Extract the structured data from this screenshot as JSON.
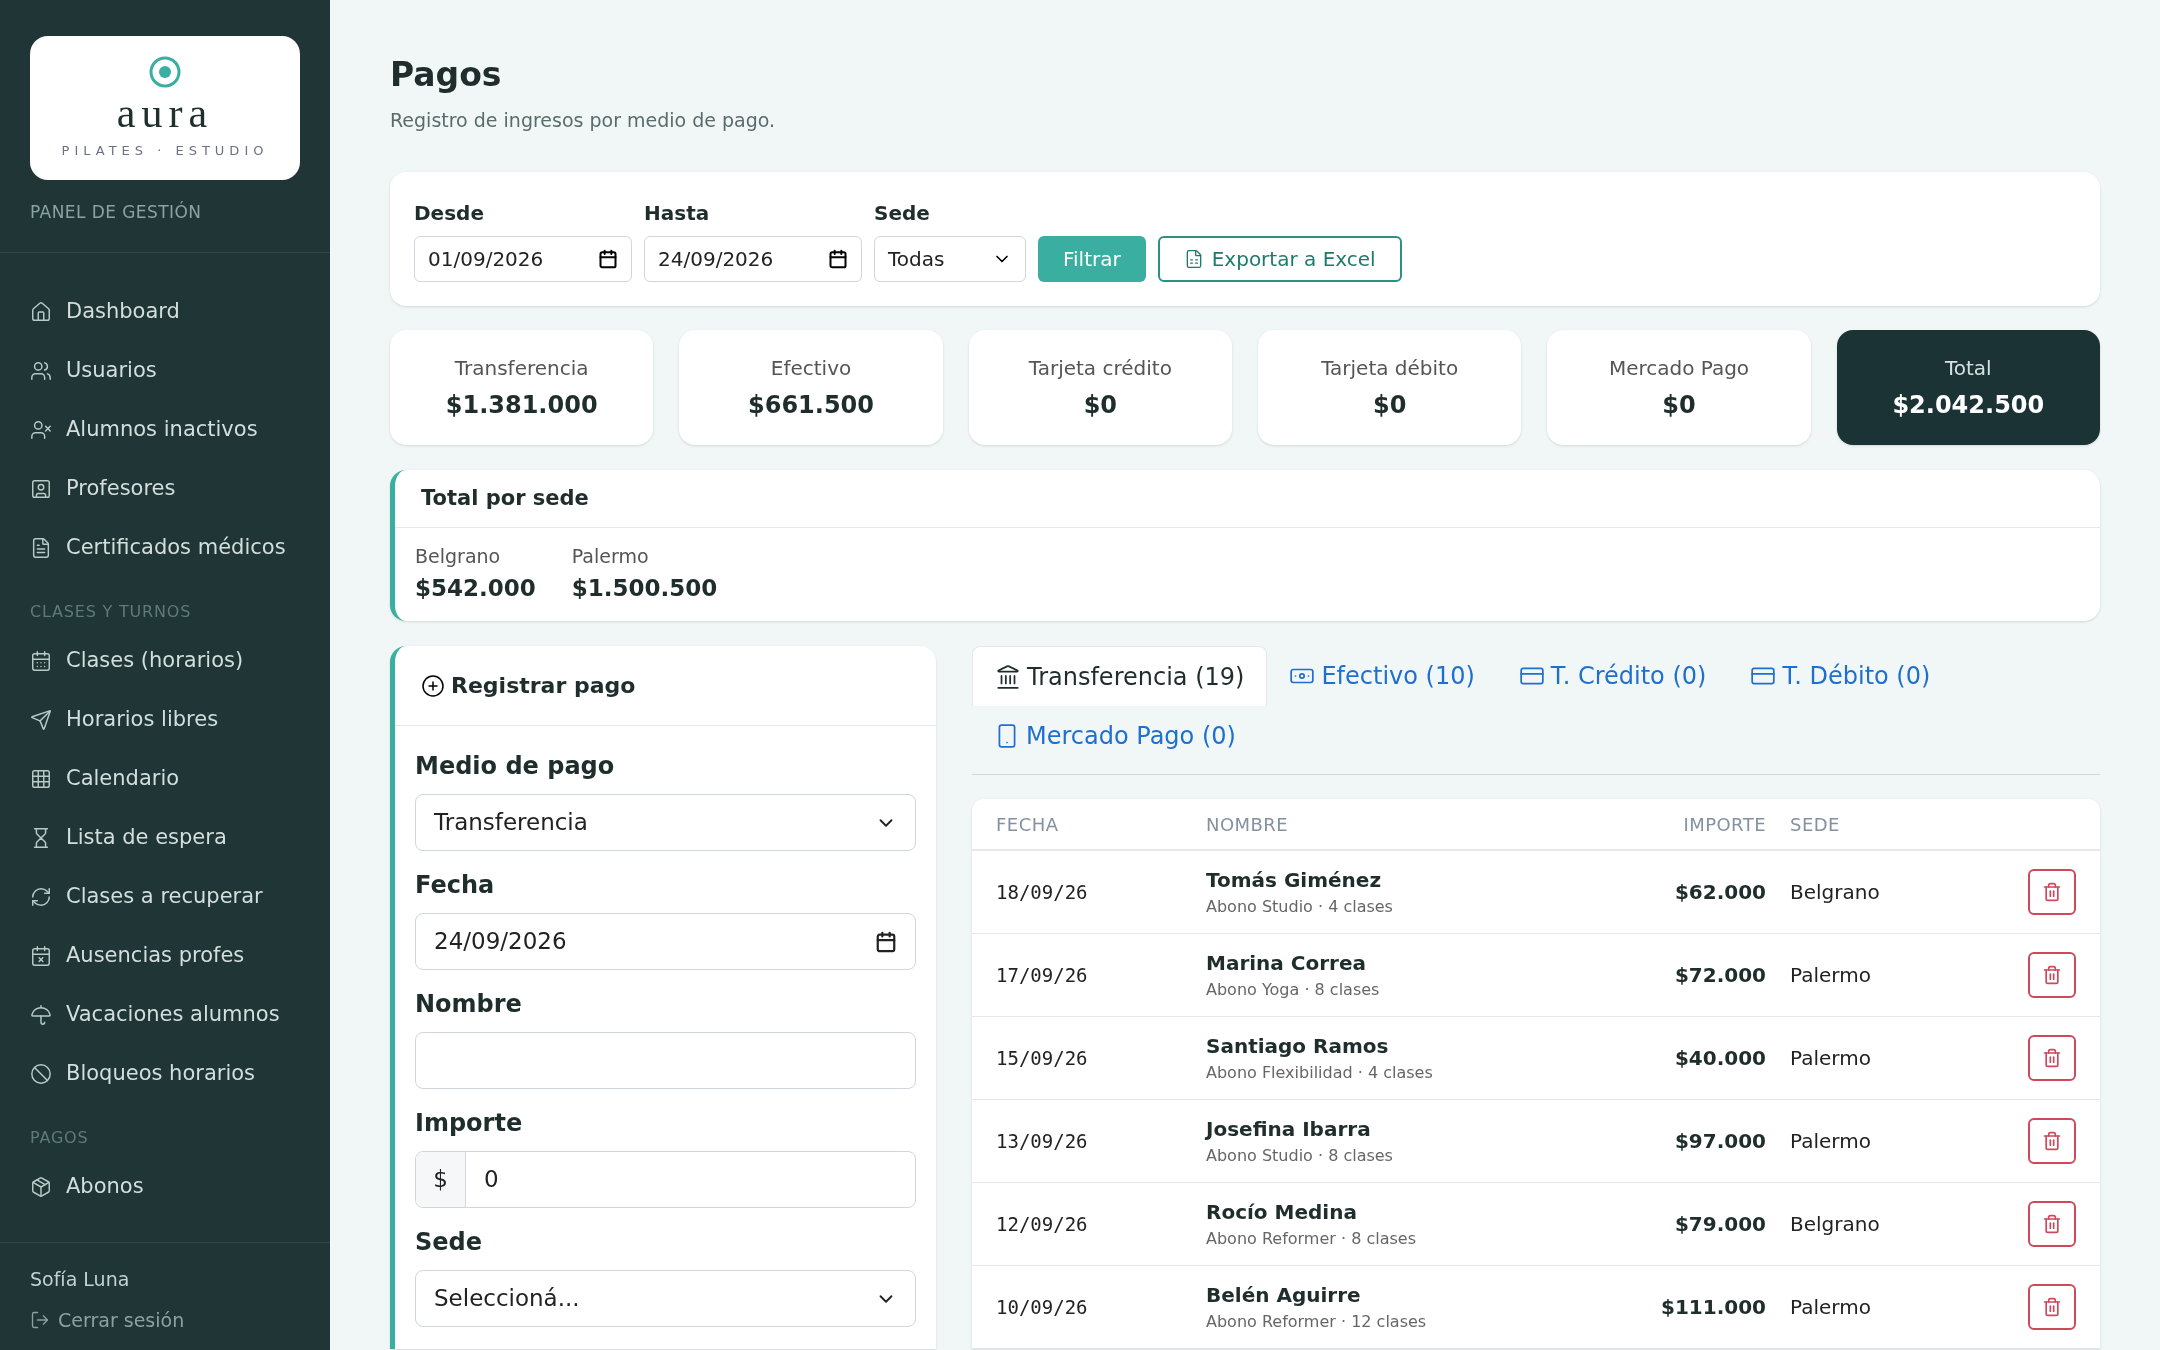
{
  "sidebar": {
    "logo": {
      "wordmark": "aura",
      "tagline": "PILATES · ESTUDIO"
    },
    "panel_label": "PANEL DE GESTIÓN",
    "sections": [
      {
        "items": [
          {
            "label": "Dashboard"
          },
          {
            "label": "Usuarios"
          },
          {
            "label": "Alumnos inactivos"
          },
          {
            "label": "Profesores"
          },
          {
            "label": "Certificados médicos"
          }
        ]
      },
      {
        "heading": "CLASES Y TURNOS",
        "items": [
          {
            "label": "Clases (horarios)"
          },
          {
            "label": "Horarios libres"
          },
          {
            "label": "Calendario"
          },
          {
            "label": "Lista de espera"
          },
          {
            "label": "Clases a recuperar"
          },
          {
            "label": "Ausencias profes"
          },
          {
            "label": "Vacaciones alumnos"
          },
          {
            "label": "Bloqueos horarios"
          }
        ]
      },
      {
        "heading": "PAGOS",
        "items": [
          {
            "label": "Abonos"
          }
        ]
      }
    ],
    "user": "Sofía Luna",
    "logout": "Cerrar sesión"
  },
  "header": {
    "title": "Pagos",
    "subtitle": "Registro de ingresos por medio de pago."
  },
  "filters": {
    "desde": {
      "label": "Desde",
      "value": "01/09/2026"
    },
    "hasta": {
      "label": "Hasta",
      "value": "24/09/2026"
    },
    "sede": {
      "label": "Sede",
      "value": "Todas"
    },
    "filter_button": "Filtrar",
    "export_button": "Exportar a Excel"
  },
  "totals": [
    {
      "label": "Transferencia",
      "value": "$1.381.000",
      "highlighted": false
    },
    {
      "label": "Efectivo",
      "value": "$661.500",
      "highlighted": false
    },
    {
      "label": "Tarjeta crédito",
      "value": "$0",
      "highlighted": false
    },
    {
      "label": "Tarjeta débito",
      "value": "$0",
      "highlighted": false
    },
    {
      "label": "Mercado Pago",
      "value": "$0",
      "highlighted": false
    },
    {
      "label": "Total",
      "value": "$2.042.500",
      "highlighted": true
    }
  ],
  "by_sede": {
    "title": "Total por sede",
    "items": [
      {
        "label": "Belgrano",
        "value": "$542.000"
      },
      {
        "label": "Palermo",
        "value": "$1.500.500"
      }
    ]
  },
  "form": {
    "title": "Registrar pago",
    "fields": [
      {
        "kind": "select",
        "label": "Medio de pago",
        "value": "Transferencia"
      },
      {
        "kind": "date",
        "label": "Fecha",
        "value": "24/09/2026"
      },
      {
        "kind": "text",
        "label": "Nombre"
      },
      {
        "kind": "money",
        "label": "Importe",
        "prefix": "$",
        "value": "0"
      },
      {
        "kind": "select",
        "label": "Sede",
        "value": "Seleccioná..."
      }
    ]
  },
  "tabs": [
    {
      "label": "Transferencia (19)",
      "selected": true
    },
    {
      "label": "Efectivo (10)",
      "selected": false
    },
    {
      "label": "T. Crédito (0)",
      "selected": false
    },
    {
      "label": "T. Débito (0)",
      "selected": false
    },
    {
      "label": "Mercado Pago (0)",
      "selected": false
    }
  ],
  "table": {
    "columns": [
      "FECHA",
      "NOMBRE",
      "IMPORTE",
      "SEDE"
    ],
    "rows": [
      {
        "fecha": "18/09/26",
        "nombre": "Tomás Giménez",
        "detalle": "Abono Studio · 4 clases",
        "importe": "$62.000",
        "sede": "Belgrano"
      },
      {
        "fecha": "17/09/26",
        "nombre": "Marina Correa",
        "detalle": "Abono Yoga · 8 clases",
        "importe": "$72.000",
        "sede": "Palermo"
      },
      {
        "fecha": "15/09/26",
        "nombre": "Santiago Ramos",
        "detalle": "Abono Flexibilidad · 4 clases",
        "importe": "$40.000",
        "sede": "Palermo"
      },
      {
        "fecha": "13/09/26",
        "nombre": "Josefina Ibarra",
        "detalle": "Abono Studio · 8 clases",
        "importe": "$97.000",
        "sede": "Palermo"
      },
      {
        "fecha": "12/09/26",
        "nombre": "Rocío Medina",
        "detalle": "Abono Reformer · 8 clases",
        "importe": "$79.000",
        "sede": "Belgrano"
      },
      {
        "fecha": "10/09/26",
        "nombre": "Belén Aguirre",
        "detalle": "Abono Reformer · 12 clases",
        "importe": "$111.000",
        "sede": "Palermo"
      }
    ]
  }
}
